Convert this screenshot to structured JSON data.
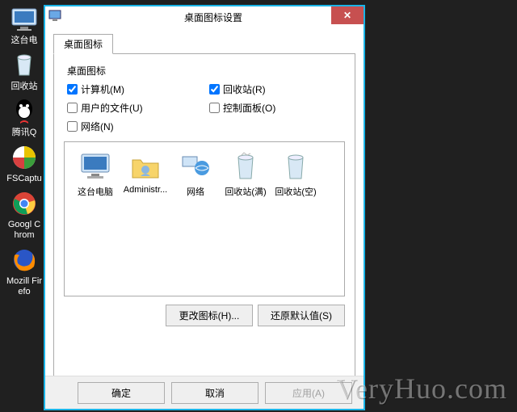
{
  "desktop": {
    "icons": [
      {
        "label": "这台电",
        "icon": "computer"
      },
      {
        "label": "回收站",
        "icon": "bin"
      },
      {
        "label": "腾讯Q",
        "icon": "qq"
      },
      {
        "label": "FSCaptu",
        "icon": "fscapture"
      },
      {
        "label": "Googl Chrom",
        "icon": "chrome"
      },
      {
        "label": "Mozill Firefo",
        "icon": "firefox"
      }
    ]
  },
  "dialog": {
    "title": "桌面图标设置",
    "tab": "桌面图标",
    "group": "桌面图标",
    "checks": [
      {
        "label": "计算机(M)",
        "checked": true
      },
      {
        "label": "回收站(R)",
        "checked": true
      },
      {
        "label": "用户的文件(U)",
        "checked": false
      },
      {
        "label": "控制面板(O)",
        "checked": false
      },
      {
        "label": "网络(N)",
        "checked": false
      }
    ],
    "preview": [
      {
        "label": "这台电脑",
        "icon": "computer"
      },
      {
        "label": "Administr...",
        "icon": "folder"
      },
      {
        "label": "网络",
        "icon": "network"
      },
      {
        "label": "回收站(满)",
        "icon": "binfull"
      },
      {
        "label": "回收站(空)",
        "icon": "bin"
      }
    ],
    "change_icon": "更改图标(H)...",
    "restore": "还原默认值(S)",
    "ok": "确定",
    "cancel": "取消",
    "apply": "应用(A)"
  },
  "watermark": "VeryHuo.com"
}
